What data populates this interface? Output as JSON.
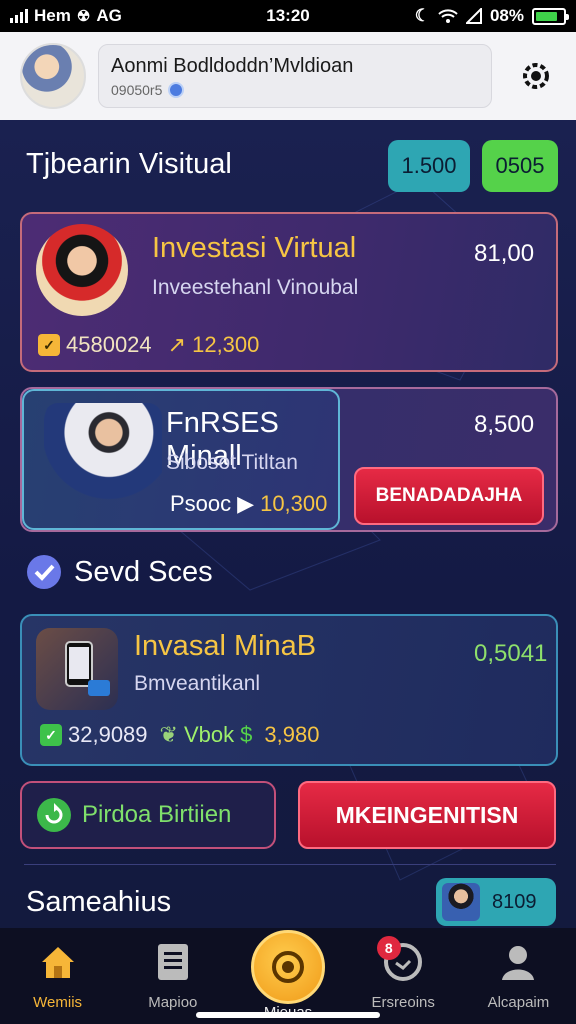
{
  "status_bar": {
    "carrier": "Hem",
    "network_label": "AG",
    "time": "13:20",
    "battery_text": "08%",
    "battery_level": 0.8
  },
  "header": {
    "title": "Aonmi Bodldoddn’Mvldioan",
    "subtitle": "09050r5"
  },
  "section_main": {
    "title": "Tjbearin Visitual",
    "pill_left": "1.500",
    "pill_right": "0505"
  },
  "card1": {
    "title": "Investasi Virtual",
    "subtitle": "Inveestehanl Vinoubal",
    "value": "81,00",
    "meta_left": "4580024",
    "meta_right": "12,300"
  },
  "card2": {
    "title": "FnRSES Minall",
    "subtitle": "Sibosot Titltan",
    "value": "8,500",
    "meta_left": "Psooc",
    "meta_right": "10,300",
    "action_label": "BENADADAJHA"
  },
  "section_saved": {
    "title": "Sevd Sces"
  },
  "card3": {
    "title": "Invasal MinaB",
    "subtitle": "Bmveantikanl",
    "value": "0,5041",
    "meta_left": "32,9089",
    "meta_mid": "Vbok",
    "meta_right": "3,980"
  },
  "actions": {
    "left_label": "Pirdoa Birtiien",
    "right_label": "MKEINGENITISN"
  },
  "section_bottom": {
    "title": "Sameahius",
    "chip_value": "8109"
  },
  "nav": {
    "items": [
      {
        "label": "Wemiis",
        "icon": "home-icon"
      },
      {
        "label": "Mapioo",
        "icon": "document-icon"
      },
      {
        "label": "Mieuas",
        "icon": "camera-icon"
      },
      {
        "label": "Ersreoins",
        "icon": "clock-icon"
      },
      {
        "label": "Alcapaim",
        "icon": "profile-icon"
      }
    ],
    "badge_count": "8"
  },
  "colors": {
    "accent_gold": "#f6b638",
    "accent_red": "#e62a45",
    "accent_green": "#55d24a",
    "accent_teal": "#2ea6b3"
  }
}
